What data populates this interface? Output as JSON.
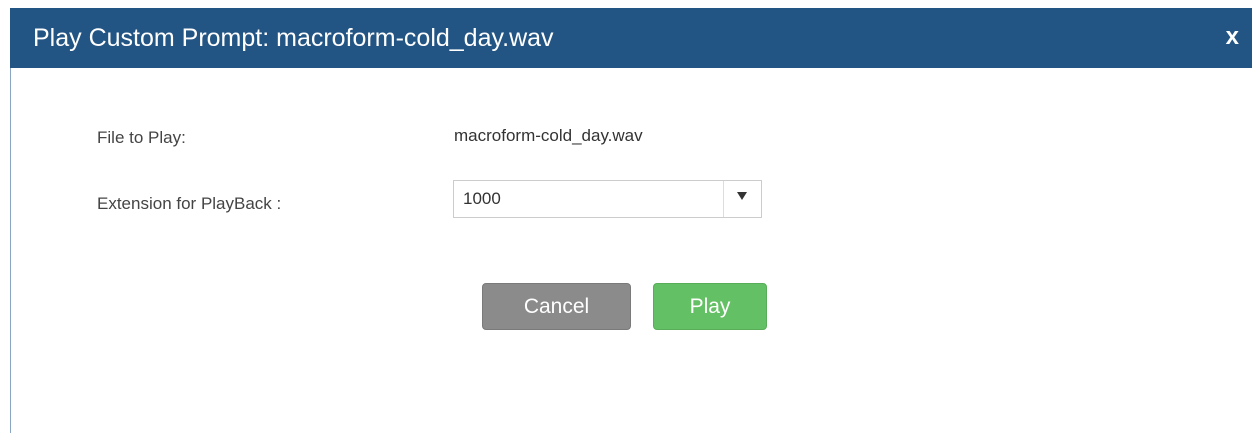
{
  "dialog": {
    "title": "Play Custom Prompt: macroform-cold_day.wav",
    "close_label": "x"
  },
  "form": {
    "file_label": "File to Play:",
    "file_value": "macroform-cold_day.wav",
    "extension_label": "Extension for PlayBack :",
    "extension_value": "1000"
  },
  "buttons": {
    "cancel_label": "Cancel",
    "play_label": "Play"
  },
  "colors": {
    "titlebar": "#235584",
    "cancel": "#8b8b8b",
    "play": "#64c064"
  }
}
